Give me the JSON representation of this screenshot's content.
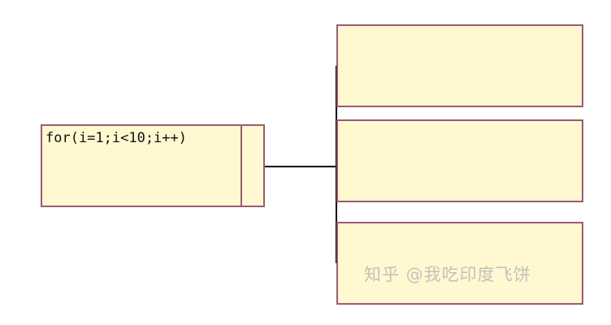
{
  "diagram": {
    "loop_statement": "for(i=1;i<10;i++)",
    "body_blocks": [
      {
        "text": ""
      },
      {
        "text": ""
      },
      {
        "text": ""
      }
    ],
    "watermark": "知乎 @我吃印度飞饼",
    "colors": {
      "box_fill": "#fff8d0",
      "box_border": "#9b5a72",
      "connector": "#000000",
      "background": "#ffffff"
    }
  }
}
